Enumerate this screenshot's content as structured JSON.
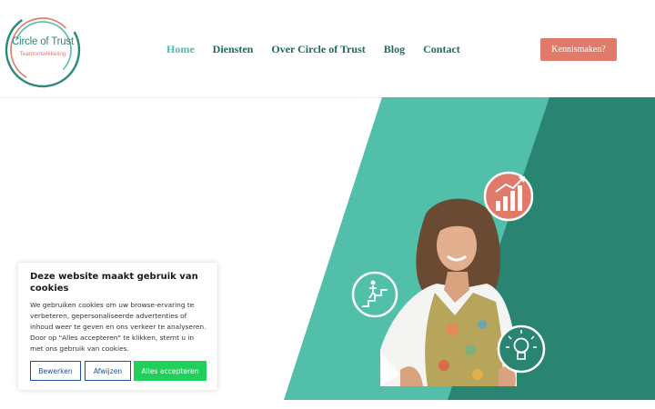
{
  "logo": {
    "title": "Circle of Trust",
    "subtitle": "Teamontwikkeling"
  },
  "nav": {
    "items": [
      "Home",
      "Diensten",
      "Over Circle of Trust",
      "Blog",
      "Contact"
    ],
    "active": "Home"
  },
  "cta": {
    "label": "Kennismaken?"
  },
  "hero": {
    "icons": [
      "growth-chart-icon",
      "stairs-climber-icon",
      "lightbulb-icon"
    ]
  },
  "cookie": {
    "title": "Deze website maakt gebruik van cookies",
    "text": "We gebruiken cookies om uw browse-ervaring te verbeteren, gepersonaliseerde advertenties of inhoud weer te geven en ons verkeer te analyseren. Door op \"Alles accepteren\" te klikken, stemt u in met ons gebruik van cookies.",
    "buttons": {
      "edit": "Bewerken",
      "reject": "Afwijzen",
      "accept": "Alles accepteren"
    }
  },
  "colors": {
    "teal_light": "#52bfaa",
    "teal_dark": "#2a8472",
    "coral": "#e07a6a",
    "accept_green": "#1fd15a",
    "button_blue": "#1e4f9c"
  }
}
